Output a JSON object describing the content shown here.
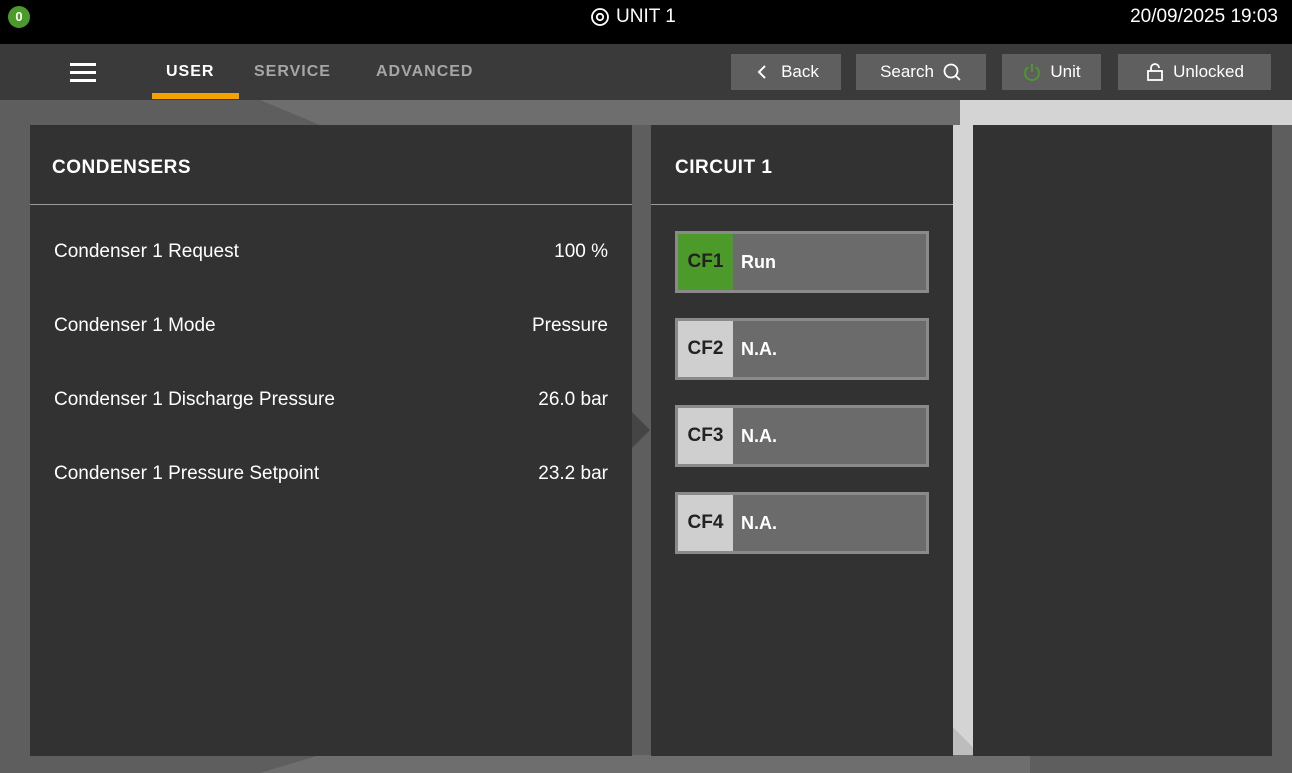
{
  "status_bar": {
    "badge_count": "0",
    "unit_title": "UNIT 1",
    "datetime": "20/09/2025 19:03"
  },
  "nav": {
    "tabs": [
      {
        "label": "USER",
        "active": true
      },
      {
        "label": "SERVICE",
        "active": false
      },
      {
        "label": "ADVANCED",
        "active": false
      }
    ],
    "buttons": {
      "back": "Back",
      "search": "Search",
      "unit": "Unit",
      "lock": "Unlocked"
    }
  },
  "condensers": {
    "title": "CONDENSERS",
    "rows": [
      {
        "label": "Condenser 1 Request",
        "value": "100 %"
      },
      {
        "label": "Condenser 1 Mode",
        "value": "Pressure"
      },
      {
        "label": "Condenser 1 Discharge Pressure",
        "value": "26.0 bar"
      },
      {
        "label": "Condenser 1 Pressure Setpoint",
        "value": "23.2 bar"
      }
    ]
  },
  "circuit": {
    "title": "CIRCUIT 1",
    "fans": [
      {
        "code": "CF1",
        "status": "Run",
        "state": "run"
      },
      {
        "code": "CF2",
        "status": "N.A.",
        "state": "na"
      },
      {
        "code": "CF3",
        "status": "N.A.",
        "state": "na"
      },
      {
        "code": "CF4",
        "status": "N.A.",
        "state": "na"
      }
    ]
  },
  "colors": {
    "accent": "#f5a100",
    "run_green": "#4c9a2a",
    "panel": "#323232",
    "background": "#5e5e5e"
  }
}
